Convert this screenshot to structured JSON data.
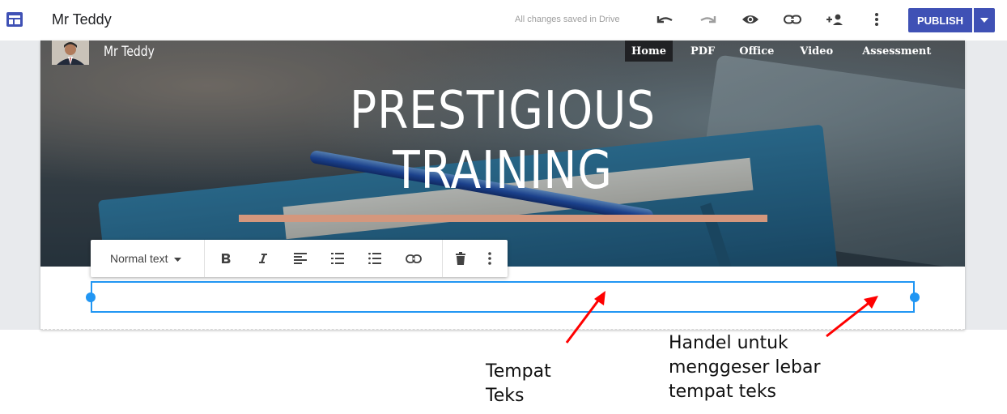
{
  "app": {
    "title": "Mr Teddy",
    "status": "All changes saved in Drive",
    "publish_label": "PUBLISH",
    "toolbar_icons": [
      "undo-icon",
      "redo-icon",
      "preview-eye-icon",
      "link-icon",
      "add-person-icon",
      "more-vert-icon"
    ]
  },
  "site": {
    "name": "Mr Teddy",
    "nav": [
      "Home",
      "PDF",
      "Office",
      "Video",
      "Assessment"
    ],
    "active_nav": "Home",
    "hero_title_line1": "PRESTIGIOUS",
    "hero_title_line2": "TRAINING"
  },
  "text_toolbar": {
    "style_label": "Normal text",
    "buttons": [
      "bold-icon",
      "italic-icon",
      "align-left-icon",
      "numbered-list-icon",
      "bulleted-list-icon",
      "link-icon",
      "delete-icon",
      "more-vert-icon"
    ]
  },
  "annotations": {
    "text_area": [
      "Tempat",
      "Teks"
    ],
    "handle": [
      "Handel untuk",
      "menggeser lebar",
      "tempat teks"
    ]
  },
  "colors": {
    "accent": "#3f51b5",
    "selection": "#2196f3",
    "underline": "#d4977d",
    "arrow": "#ff0000"
  }
}
